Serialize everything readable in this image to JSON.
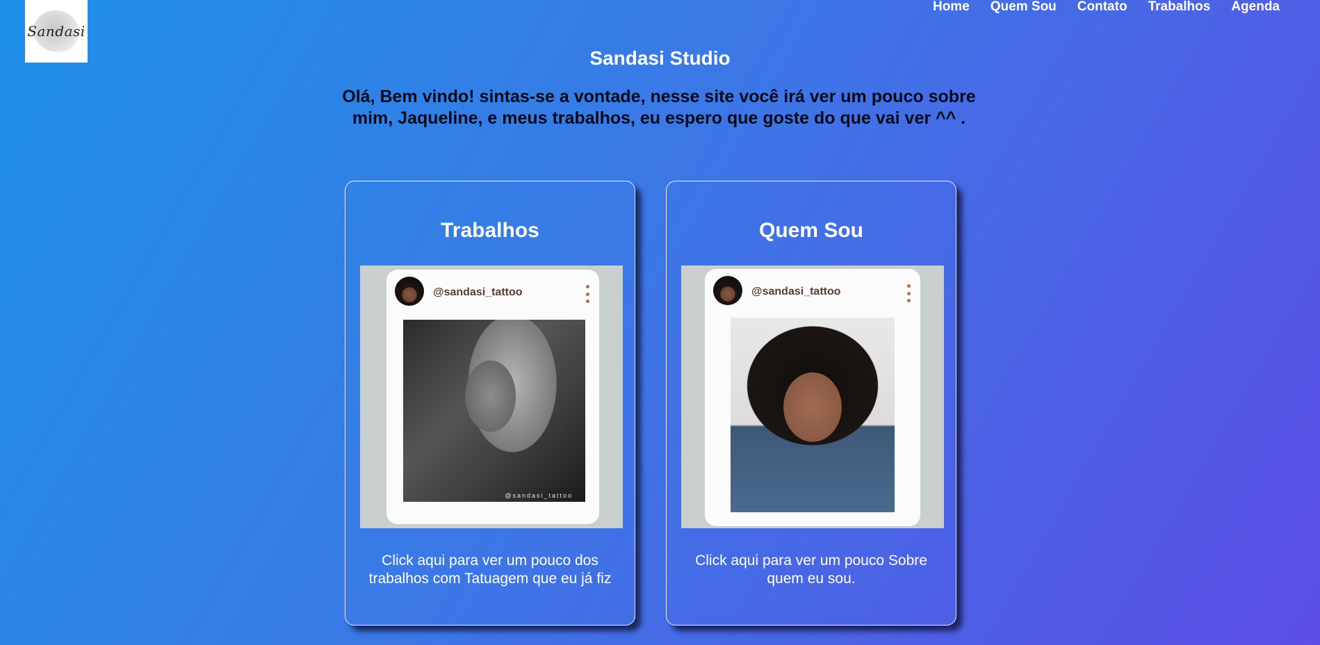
{
  "logo": {
    "text": "Sandasi"
  },
  "nav": {
    "items": [
      "Home",
      "Quem Sou",
      "Contato",
      "Trabalhos",
      "Agenda"
    ]
  },
  "header": {
    "title": "Sandasi Studio",
    "intro": "Olá, Bem vindo! sintas-se a vontade, nesse site você irá ver um pouco sobre mim, Jaqueline, e meus trabalhos, eu espero que goste do que vai ver ^^ ."
  },
  "cards": [
    {
      "title": "Trabalhos",
      "image": {
        "handle": "@sandasi_tattoo",
        "watermark": "@sandasi_tattoo"
      },
      "text": "Click aqui para ver um pouco dos trabalhos com Tatuagem que eu já fiz"
    },
    {
      "title": "Quem Sou",
      "image": {
        "handle": "@sandasi_tattoo"
      },
      "text": "Click aqui para ver um pouco Sobre quem eu sou."
    }
  ],
  "colors": {
    "gradient_start": "#1e90e8",
    "gradient_end": "#5c4de6",
    "intro_text": "#0a0a1a",
    "handle_text": "#5a3b30",
    "dots": "#b8694c"
  }
}
